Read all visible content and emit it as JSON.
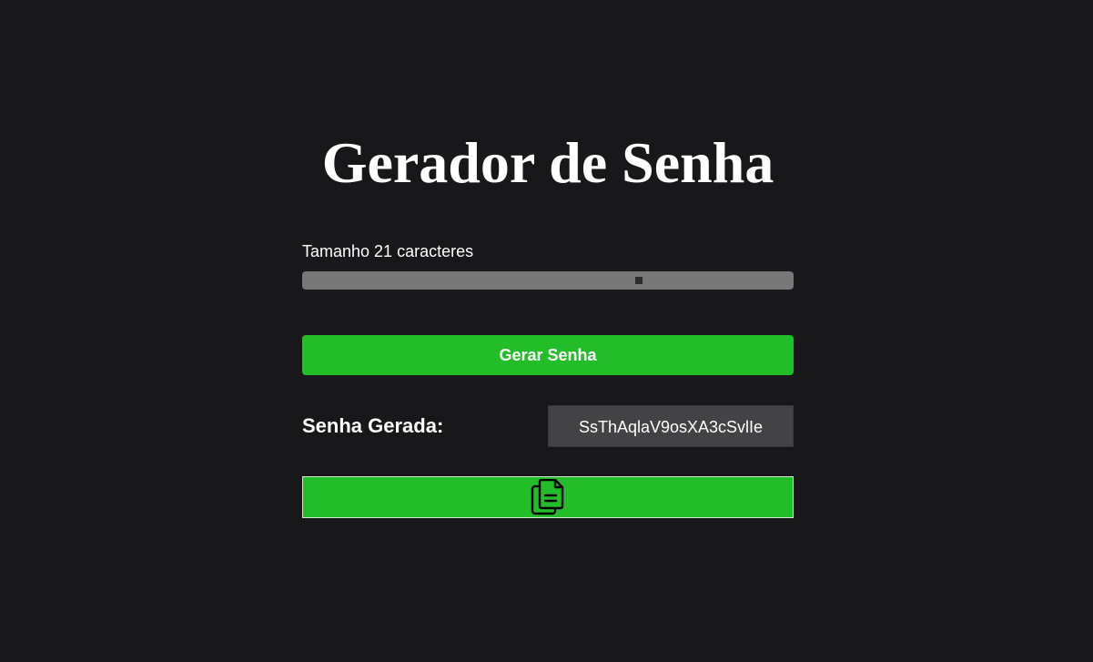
{
  "app": {
    "title": "Gerador de Senha"
  },
  "length_control": {
    "label": "Tamanho 21 caracteres",
    "value": 21,
    "slider_fraction": 0.685
  },
  "generate_button": {
    "label": "Gerar Senha"
  },
  "result": {
    "label": "Senha Gerada:",
    "password": "SsThAqlaV9osXA3cSvlIe"
  },
  "copy_button": {
    "icon": "copy-document-icon"
  },
  "colors": {
    "background": "#18181a",
    "accent": "#23bd2a",
    "slider_track": "#777777",
    "output_bg": "#434345",
    "text": "#ffffff"
  }
}
